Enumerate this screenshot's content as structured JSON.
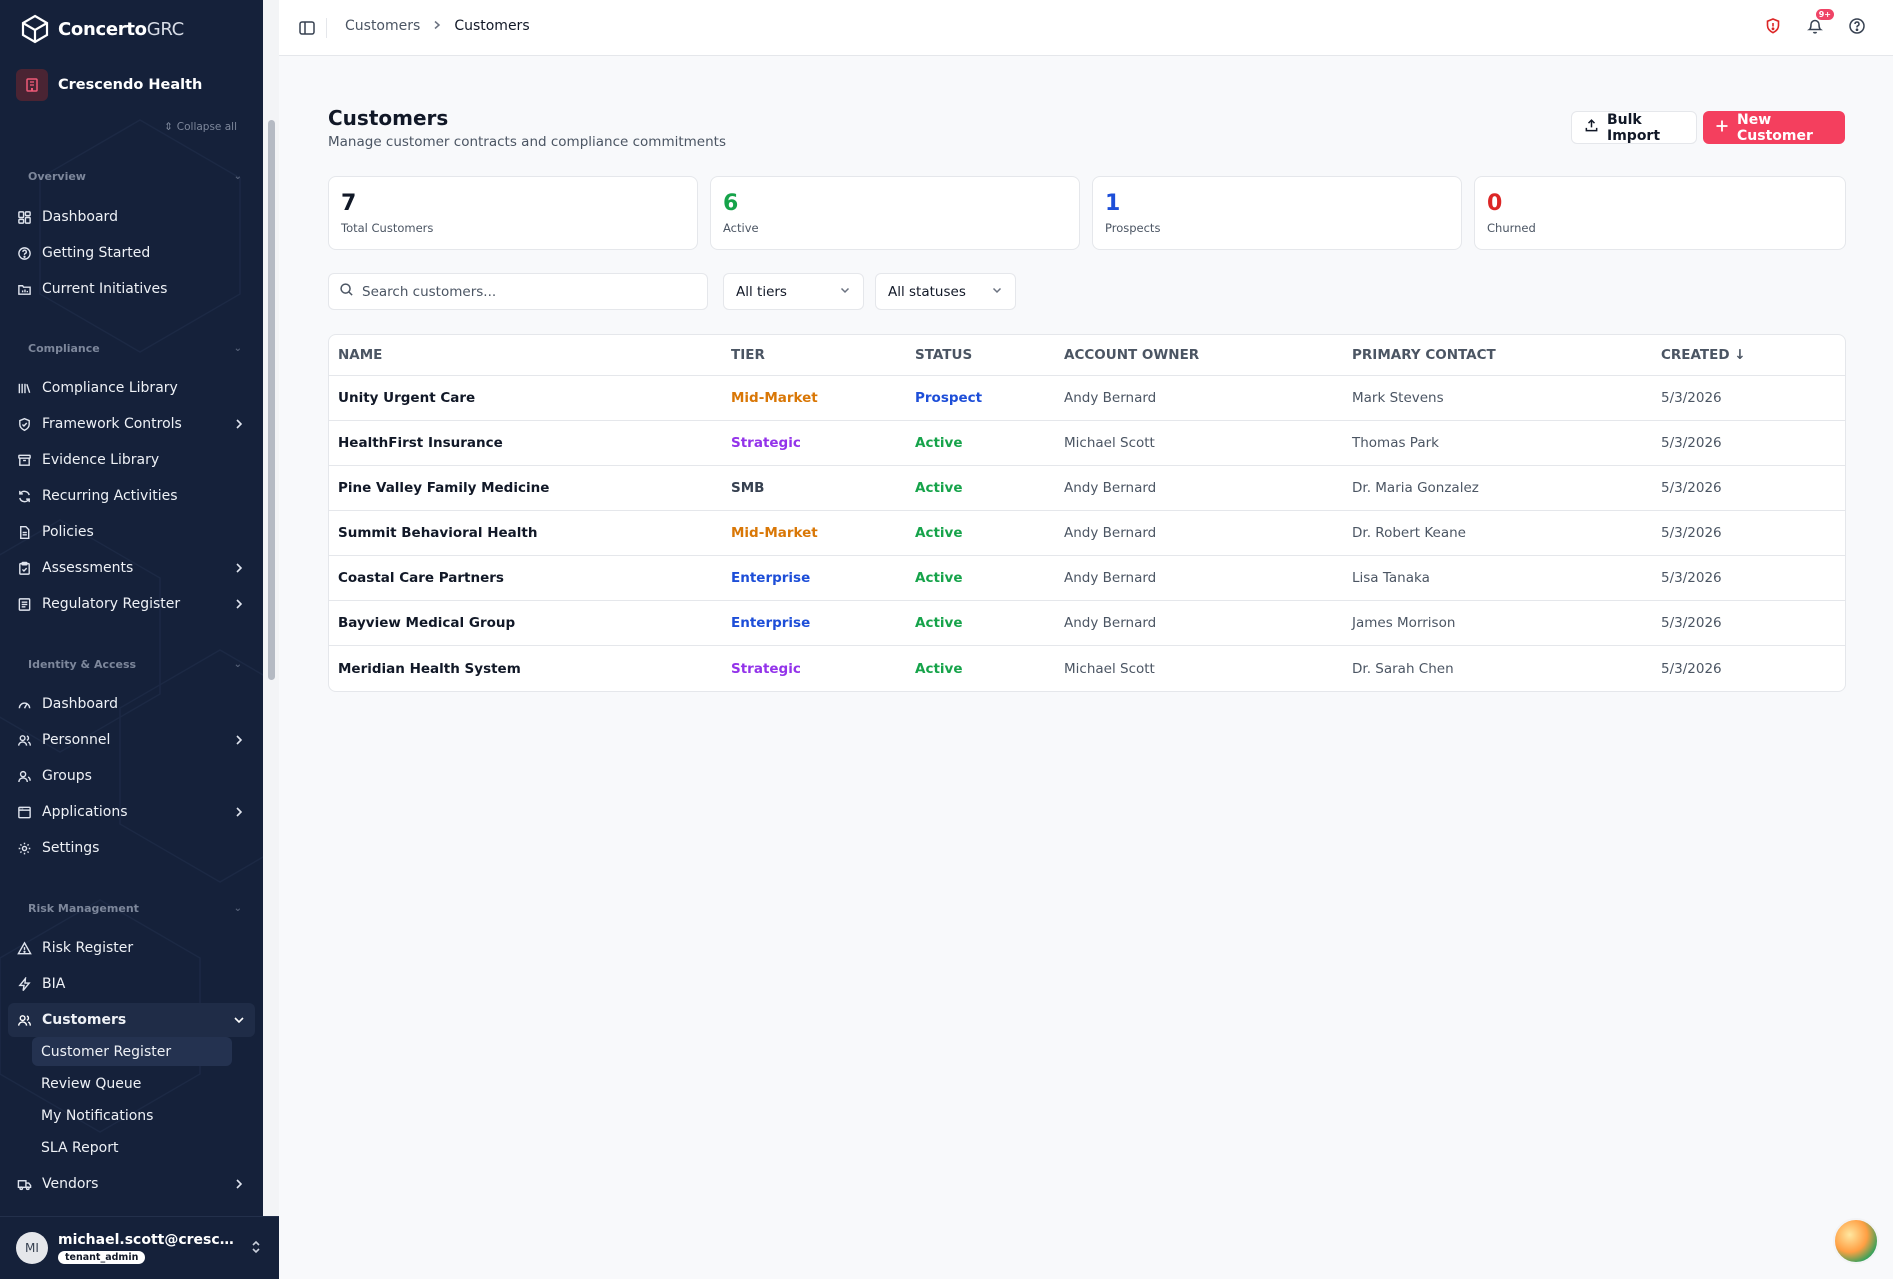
{
  "brand": {
    "name_bold": "Concerto",
    "name_light": "GRC"
  },
  "org": {
    "name": "Crescendo Health"
  },
  "sidebar": {
    "collapse_all": "Collapse all",
    "sections": [
      {
        "title": "Overview",
        "items": [
          {
            "label": "Dashboard",
            "icon": "grid-icon"
          },
          {
            "label": "Getting Started",
            "icon": "help-circle-icon"
          },
          {
            "label": "Current Initiatives",
            "icon": "folder-chart-icon"
          }
        ]
      },
      {
        "title": "Compliance",
        "items": [
          {
            "label": "Compliance Library",
            "icon": "library-icon"
          },
          {
            "label": "Framework Controls",
            "icon": "shield-check-icon"
          },
          {
            "label": "Evidence Library",
            "icon": "archive-icon"
          },
          {
            "label": "Recurring Activities",
            "icon": "refresh-icon"
          },
          {
            "label": "Policies",
            "icon": "document-icon"
          },
          {
            "label": "Assessments",
            "icon": "clipboard-check-icon"
          },
          {
            "label": "Regulatory Register",
            "icon": "register-icon"
          }
        ]
      },
      {
        "title": "Identity & Access",
        "items": [
          {
            "label": "Dashboard",
            "icon": "gauge-icon"
          },
          {
            "label": "Personnel",
            "icon": "users-icon"
          },
          {
            "label": "Groups",
            "icon": "user-group-icon"
          },
          {
            "label": "Applications",
            "icon": "app-window-icon"
          },
          {
            "label": "Settings",
            "icon": "gear-icon"
          }
        ]
      },
      {
        "title": "Risk Management",
        "items": [
          {
            "label": "Risk Register",
            "icon": "warning-triangle-icon"
          },
          {
            "label": "BIA",
            "icon": "lightning-icon"
          },
          {
            "label": "Customers",
            "icon": "customers-icon"
          }
        ]
      }
    ],
    "customers_sub": [
      "Customer Register",
      "Review Queue",
      "My Notifications",
      "SLA Report"
    ],
    "vendors": {
      "label": "Vendors",
      "icon": "truck-icon"
    }
  },
  "user": {
    "initials": "MI",
    "email": "michael.scott@crescend...",
    "role": "tenant_admin"
  },
  "topbar": {
    "breadcrumb": [
      "Customers",
      "Customers"
    ],
    "notification_badge": "9+"
  },
  "page": {
    "title": "Customers",
    "subtitle": "Manage customer contracts and compliance commitments",
    "bulk_import": "Bulk Import",
    "new_customer": "New Customer"
  },
  "stats": [
    {
      "value": "7",
      "label": "Total Customers",
      "color": "#111827"
    },
    {
      "value": "6",
      "label": "Active",
      "color": "#16a34a"
    },
    {
      "value": "1",
      "label": "Prospects",
      "color": "#1d4ed8"
    },
    {
      "value": "0",
      "label": "Churned",
      "color": "#dc2626"
    }
  ],
  "filters": {
    "search_placeholder": "Search customers...",
    "tier": "All tiers",
    "status": "All statuses"
  },
  "table": {
    "headers": [
      "NAME",
      "TIER",
      "STATUS",
      "ACCOUNT OWNER",
      "PRIMARY CONTACT",
      "CREATED ↓"
    ],
    "rows": [
      {
        "name": "Unity Urgent Care",
        "tier": "Mid-Market",
        "status": "Prospect",
        "owner": "Andy Bernard",
        "contact": "Mark Stevens",
        "created": "5/3/2026"
      },
      {
        "name": "HealthFirst Insurance",
        "tier": "Strategic",
        "status": "Active",
        "owner": "Michael Scott",
        "contact": "Thomas Park",
        "created": "5/3/2026"
      },
      {
        "name": "Pine Valley Family Medicine",
        "tier": "SMB",
        "status": "Active",
        "owner": "Andy Bernard",
        "contact": "Dr. Maria Gonzalez",
        "created": "5/3/2026"
      },
      {
        "name": "Summit Behavioral Health",
        "tier": "Mid-Market",
        "status": "Active",
        "owner": "Andy Bernard",
        "contact": "Dr. Robert Keane",
        "created": "5/3/2026"
      },
      {
        "name": "Coastal Care Partners",
        "tier": "Enterprise",
        "status": "Active",
        "owner": "Andy Bernard",
        "contact": "Lisa Tanaka",
        "created": "5/3/2026"
      },
      {
        "name": "Bayview Medical Group",
        "tier": "Enterprise",
        "status": "Active",
        "owner": "Andy Bernard",
        "contact": "James Morrison",
        "created": "5/3/2026"
      },
      {
        "name": "Meridian Health System",
        "tier": "Strategic",
        "status": "Active",
        "owner": "Michael Scott",
        "contact": "Dr. Sarah Chen",
        "created": "5/3/2026"
      }
    ]
  },
  "colors": {
    "tier": {
      "Mid-Market": "#d97706",
      "Strategic": "#9333ea",
      "SMB": "#374151",
      "Enterprise": "#1d4ed8"
    },
    "status": {
      "Prospect": "#1d4ed8",
      "Active": "#16a34a"
    },
    "accent": "#f43f5e",
    "sidebar_bg": "#15213a"
  }
}
